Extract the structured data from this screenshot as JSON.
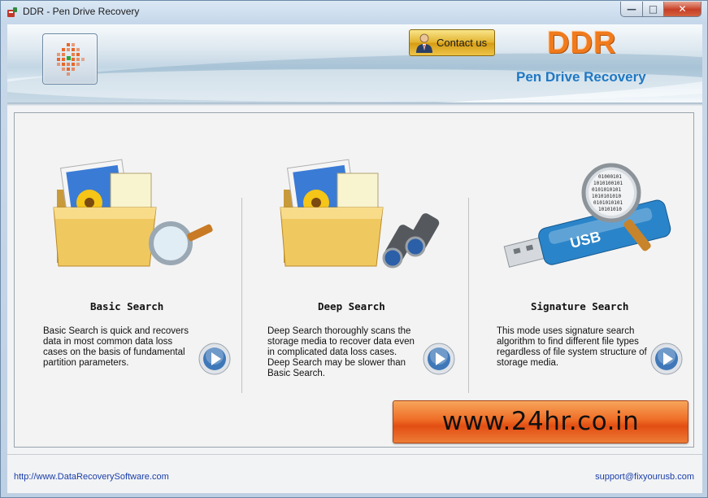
{
  "window": {
    "title": "DDR - Pen Drive Recovery",
    "caption_buttons": [
      "minimize-icon",
      "maximize-icon",
      "close-icon"
    ]
  },
  "header": {
    "contact_label": "Contact us",
    "brand_title": "DDR",
    "brand_subtitle": "Pen Drive Recovery"
  },
  "options": [
    {
      "title": "Basic Search",
      "description": "Basic Search is quick and recovers data in most common data loss cases on the basis of fundamental partition parameters.",
      "icon": "folder-magnifier-icon"
    },
    {
      "title": "Deep Search",
      "description": "Deep Search thoroughly scans the storage media to recover data even in complicated data loss cases. Deep Search may be slower than Basic Search.",
      "icon": "folder-binoculars-icon"
    },
    {
      "title": "Signature Search",
      "description": "This mode uses signature search algorithm to find different file types regardless of file system structure of storage media.",
      "icon": "usb-magnifier-icon"
    }
  ],
  "promo": {
    "text": "www.24hr.co.in"
  },
  "footer": {
    "website": "http://www.DataRecoverySoftware.com",
    "support_email": "support@fixyourusb.com"
  },
  "colors": {
    "brand_orange": "#f07a1c",
    "brand_blue": "#1f78c4",
    "link_blue": "#1a3ea8",
    "promo_orange": "#ef6d26"
  }
}
